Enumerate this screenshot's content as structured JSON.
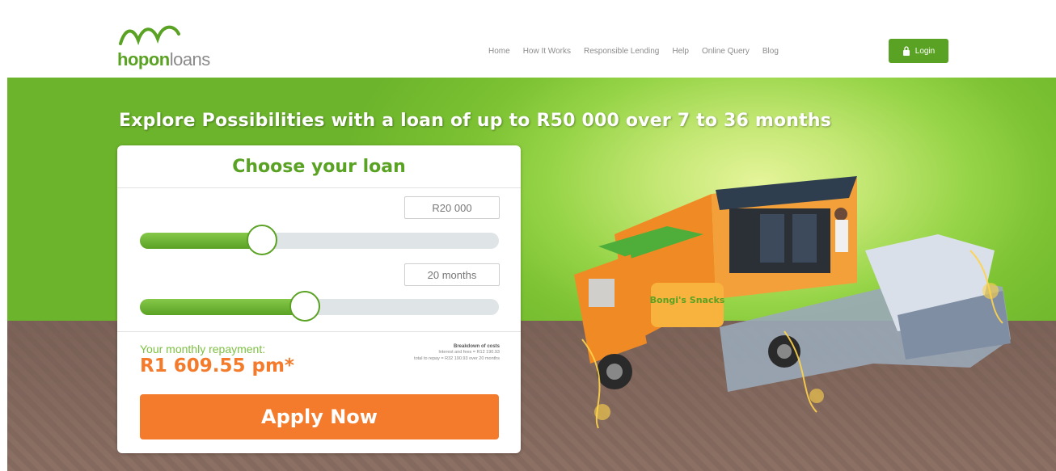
{
  "brand": {
    "name_strong": "hopon",
    "name_light": "loans",
    "color": "#5aa223"
  },
  "nav": {
    "items": [
      "Home",
      "How It Works",
      "Responsible Lending",
      "Help",
      "Online Query",
      "Blog"
    ],
    "login_label": "Login"
  },
  "hero": {
    "headline": "Explore Possibilities with a loan of up to R50 000 over 7 to 36 months"
  },
  "calculator": {
    "title": "Choose your loan",
    "amount": {
      "value": "R20 000",
      "slider_fraction": 0.34
    },
    "term": {
      "value": "20 months",
      "slider_fraction": 0.46
    },
    "repayment_label": "Your monthly repayment:",
    "repayment_value": "R1 609.55 pm*",
    "breakdown_title": "Breakdown of costs",
    "breakdown_line1": "Interest and fees = R12 190.93",
    "breakdown_line2": "total to repay = R32 190.93 over 20 months",
    "apply_label": "Apply Now"
  },
  "illustration": {
    "van_text": "Bongi's Snacks"
  },
  "colors": {
    "accent_green": "#5aa223",
    "accent_orange": "#f47a2c"
  }
}
